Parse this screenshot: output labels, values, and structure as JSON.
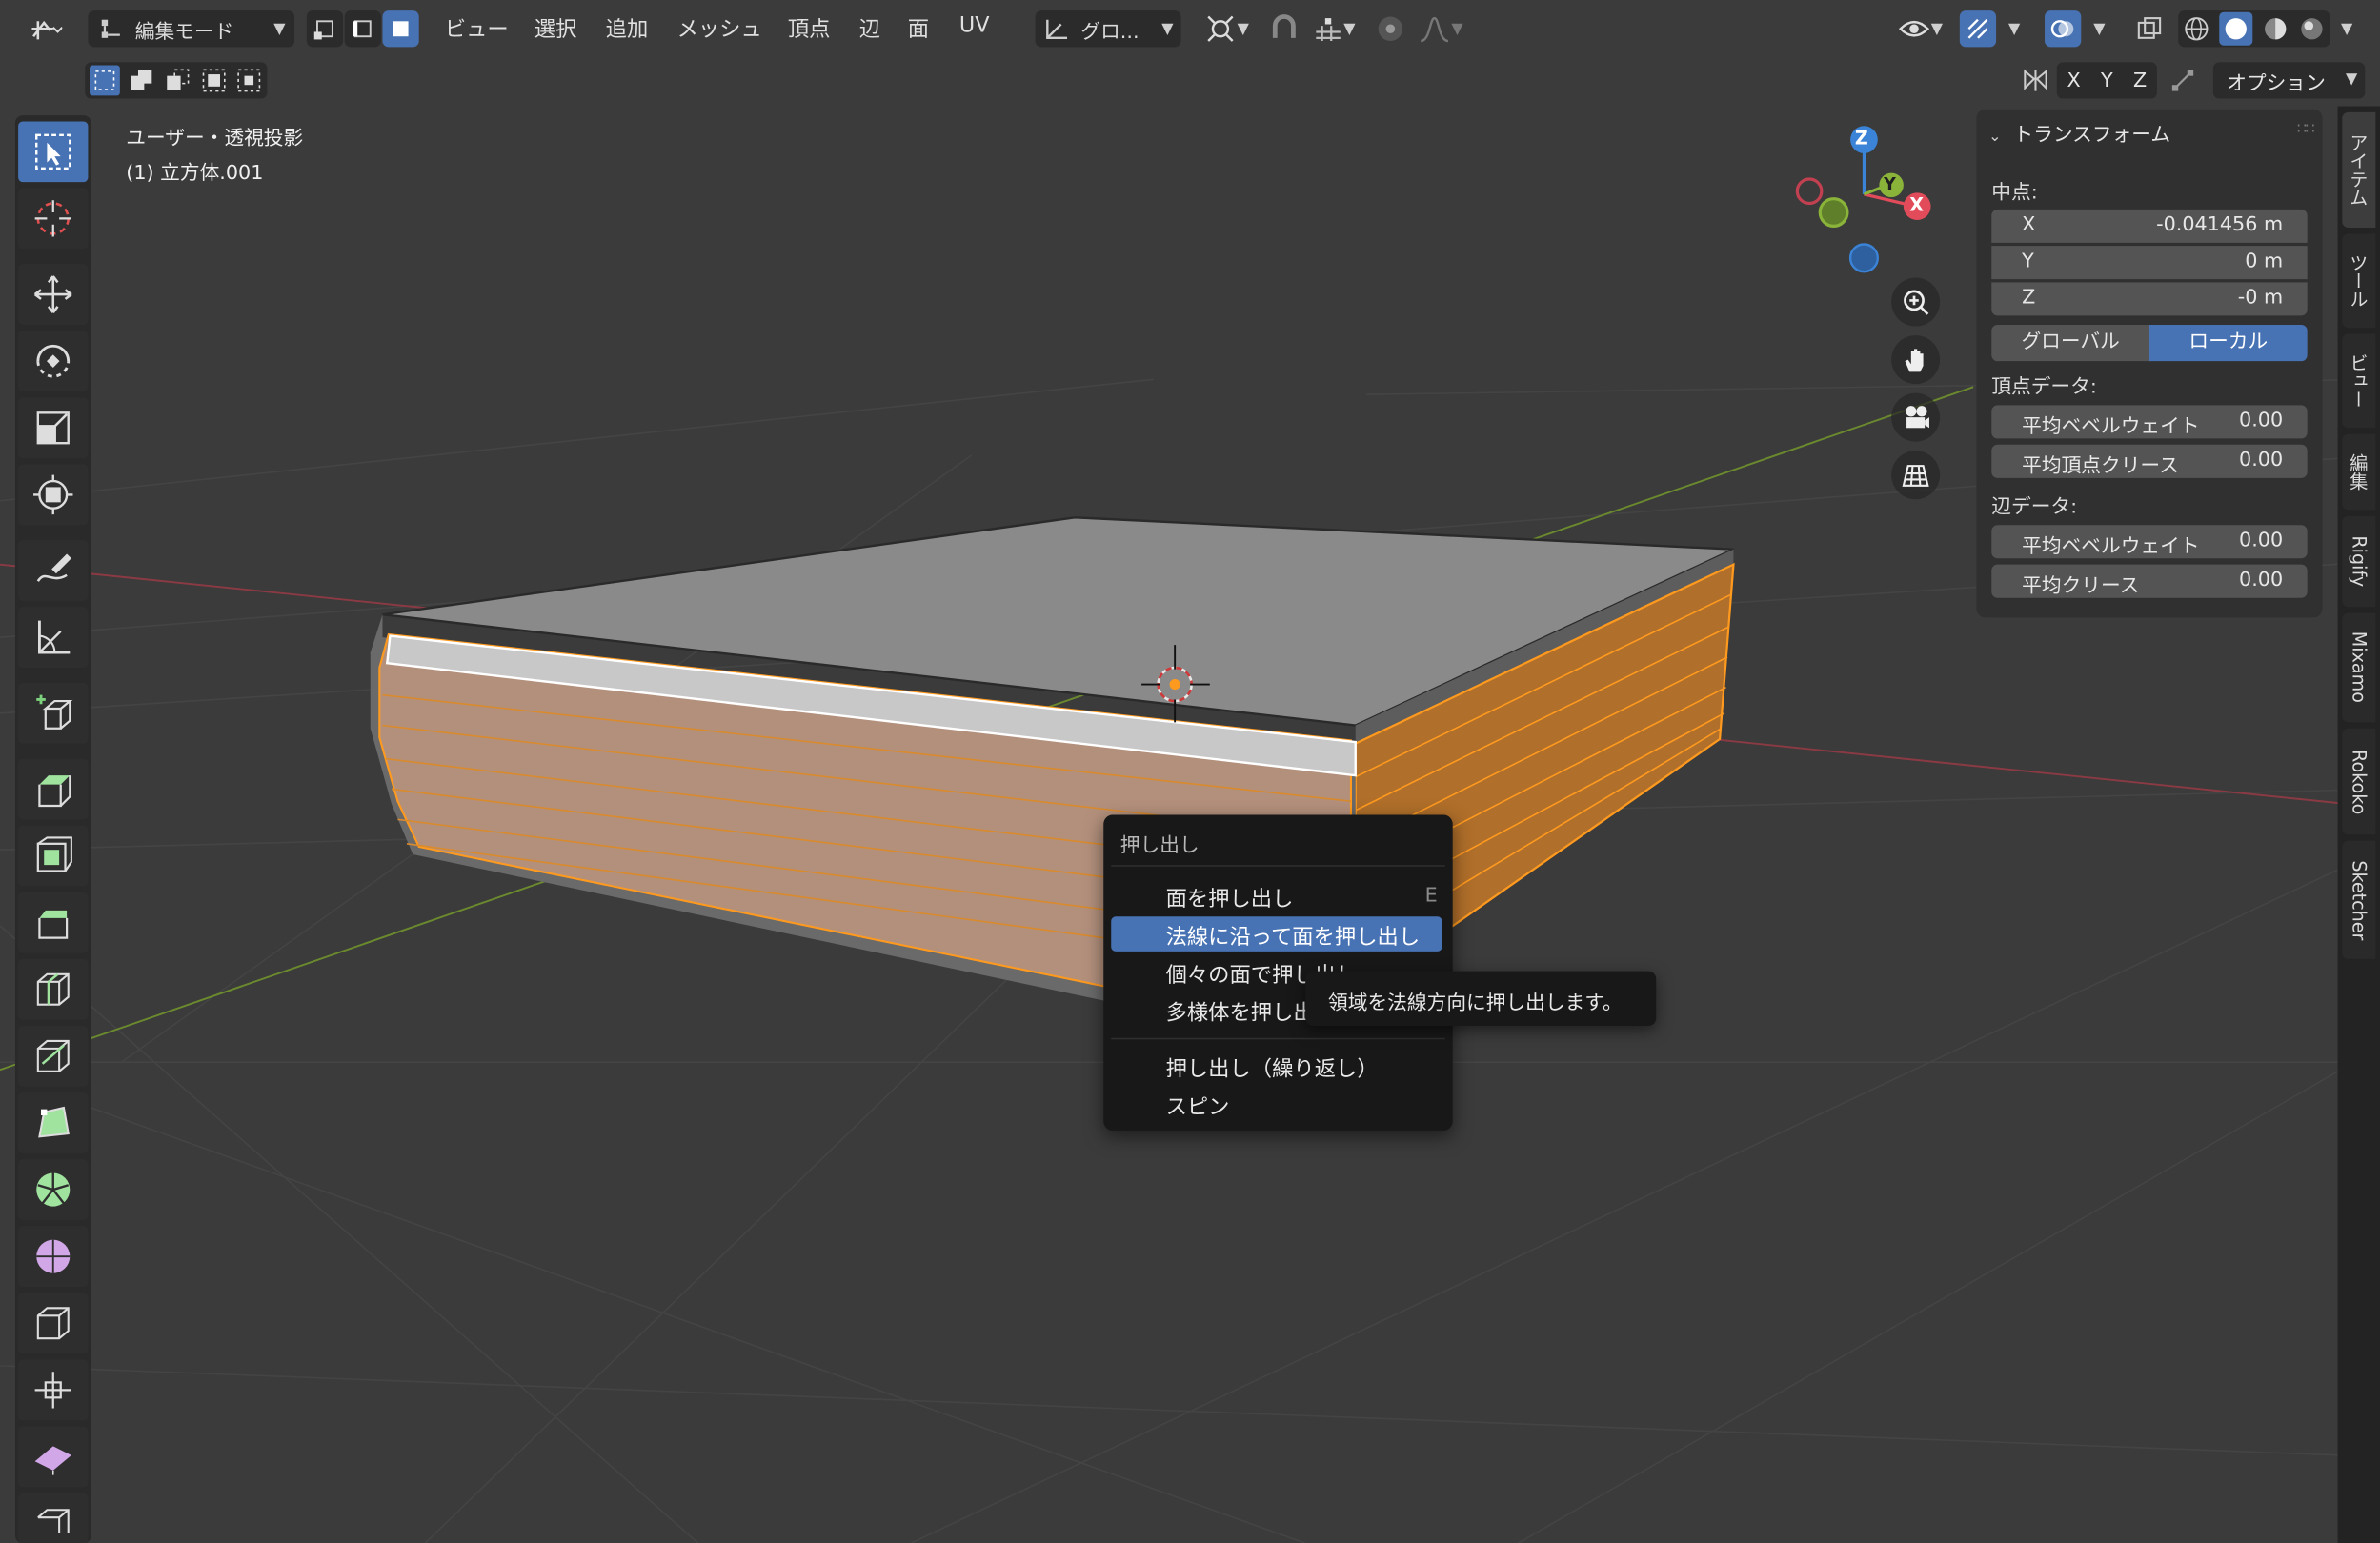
{
  "header": {
    "mode": "編集モード",
    "menus": [
      "ビュー",
      "選択",
      "追加",
      "メッシュ",
      "頂点",
      "辺",
      "面",
      "UV"
    ],
    "transform_orientation": "グロ...",
    "axes": [
      "X",
      "Y",
      "Z"
    ],
    "options": "オプション"
  },
  "overlay": {
    "view_name": "ユーザー・透視投影",
    "object_name": "(1) 立方体.001"
  },
  "gizmo": {
    "z": "Z",
    "y": "Y",
    "x": "X"
  },
  "npanel": {
    "title": "トランスフォーム",
    "median_label": "中点:",
    "fields": [
      {
        "label": "X",
        "value": "-0.041456 m"
      },
      {
        "label": "Y",
        "value": "0 m"
      },
      {
        "label": "Z",
        "value": "-0 m"
      }
    ],
    "global": "グローバル",
    "local": "ローカル",
    "vertex_data_label": "頂点データ:",
    "vertex_fields": [
      {
        "label": "平均ベベルウェイト",
        "value": "0.00"
      },
      {
        "label": "平均頂点クリース",
        "value": "0.00"
      }
    ],
    "edge_data_label": "辺データ:",
    "edge_fields": [
      {
        "label": "平均ベベルウェイト",
        "value": "0.00"
      },
      {
        "label": "平均クリース",
        "value": "0.00"
      }
    ]
  },
  "side_tabs": [
    "アイテム",
    "ツール",
    "ビュー",
    "編集",
    "Rigify",
    "Mixamo",
    "Rokoko",
    "Sketcher"
  ],
  "context_menu": {
    "title": "押し出し",
    "items": [
      {
        "label": "面を押し出し",
        "shortcut": "E"
      },
      {
        "label": "法線に沿って面を押し出し"
      },
      {
        "label": "個々の面で押し出し"
      },
      {
        "label": "多様体を押し出し"
      },
      {
        "label": "押し出し（繰り返し）"
      },
      {
        "label": "スピン"
      }
    ]
  },
  "tooltip": "領域を法線方向に押し出します。",
  "colors": {
    "accent": "#4772b3",
    "selection": "#ff9a1f",
    "axis_x": "#e24b5a",
    "axis_y": "#8ab33a",
    "axis_z": "#3b83d6"
  }
}
